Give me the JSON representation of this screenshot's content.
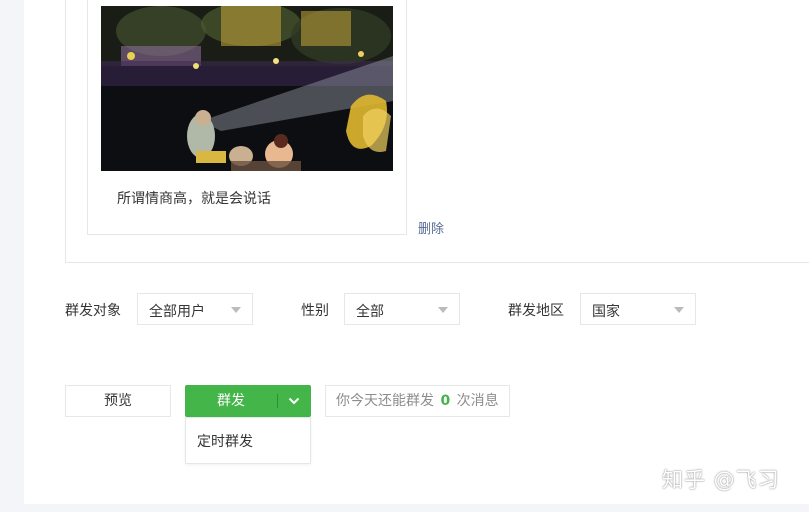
{
  "article": {
    "title": "所谓情商高，就是会说话",
    "delete_label": "删除"
  },
  "filters": {
    "target": {
      "label": "群发对象",
      "value": "全部用户"
    },
    "gender": {
      "label": "性别",
      "value": "全部"
    },
    "region": {
      "label": "群发地区",
      "value": "国家"
    }
  },
  "actions": {
    "preview_label": "预览",
    "send_label": "群发",
    "quota_prefix": "你今天还能群发",
    "quota_count": "0",
    "quota_suffix": "次消息",
    "dropdown_items": [
      "定时群发"
    ]
  },
  "watermark": "知乎 @飞习",
  "colors": {
    "accent": "#44b549",
    "link": "#576b95"
  }
}
